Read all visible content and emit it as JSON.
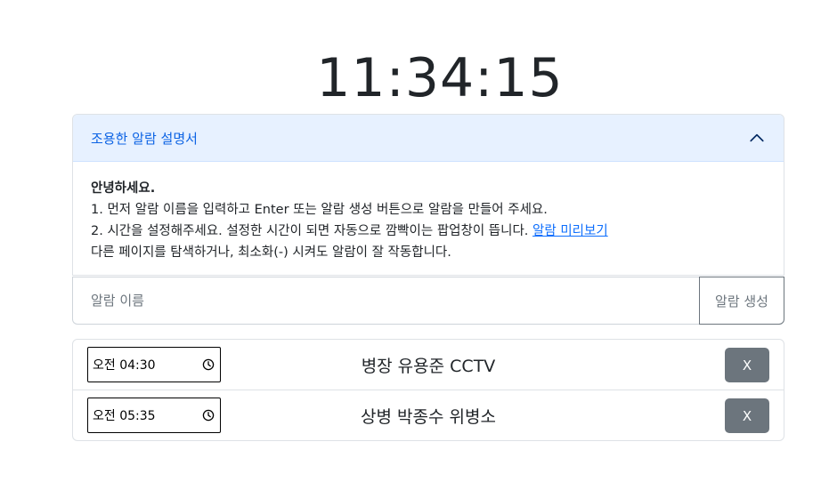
{
  "clock": {
    "time": "11:34:15"
  },
  "guide": {
    "title": "조용한 알람 설명서",
    "expanded": true,
    "greeting": "안녕하세요.",
    "line1": "1. 먼저 알람 이름을 입력하고 Enter 또는 알람 생성 버튼으로 알람을 만들어 주세요.",
    "line2": "2. 시간을 설정해주세요. 설정한 시간이 되면 자동으로 깜빡이는 팝업창이 뜹니다.",
    "line2_link": "알람 미리보기",
    "line3": "다른 페이지를 탐색하거나, 최소화(-) 시켜도 알람이 잘 작동합니다."
  },
  "create": {
    "placeholder": "알람 이름",
    "button_label": "알람 생성"
  },
  "alarms": [
    {
      "time": "오전 04:30",
      "name": "병장 유용준 CCTV",
      "delete_label": "X"
    },
    {
      "time": "오전 05:35",
      "name": "상병 박종수 위병소",
      "delete_label": "X"
    }
  ],
  "icons": {
    "accordion_toggle": "chevron-up-icon",
    "time_picker": "clock-icon"
  },
  "colors": {
    "accordion_header_bg": "#e7f1ff",
    "accordion_title": "#0c63e4",
    "link": "#0d6efd",
    "delete_button": "#6c757d"
  }
}
